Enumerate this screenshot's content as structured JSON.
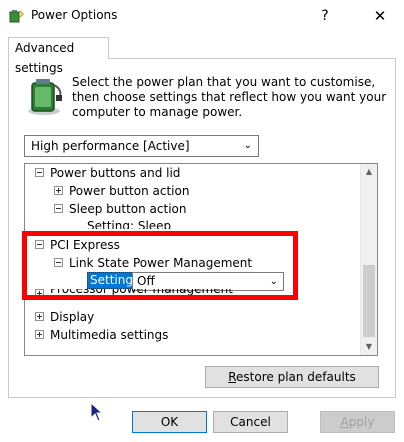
{
  "window": {
    "title": "Power Options",
    "help_glyph": "?",
    "close_glyph": "✕"
  },
  "tab": {
    "label": "Advanced settings"
  },
  "description": "Select the power plan that you want to customise, then choose settings that reflect how you want your computer to manage power.",
  "plan_select": {
    "value": "High performance [Active]"
  },
  "tree": {
    "items": [
      {
        "label": "Power buttons and lid"
      },
      {
        "label": "Power button action"
      },
      {
        "label": "Sleep button action"
      },
      {
        "label": "Setting: Sleep"
      },
      {
        "label": "PCI Express"
      },
      {
        "label": "Link State Power Management"
      },
      {
        "label": "Processor power management"
      },
      {
        "label": "Display"
      },
      {
        "label": "Multimedia settings"
      }
    ],
    "setting_label": "Setting:",
    "setting_value": "Off"
  },
  "buttons": {
    "restore_pre": "R",
    "restore_rest": "estore plan defaults",
    "ok": "OK",
    "cancel": "Cancel",
    "apply_pre": "A",
    "apply_rest": "pply"
  },
  "colors": {
    "highlight": "#ff0000",
    "selection": "#0078d7"
  }
}
